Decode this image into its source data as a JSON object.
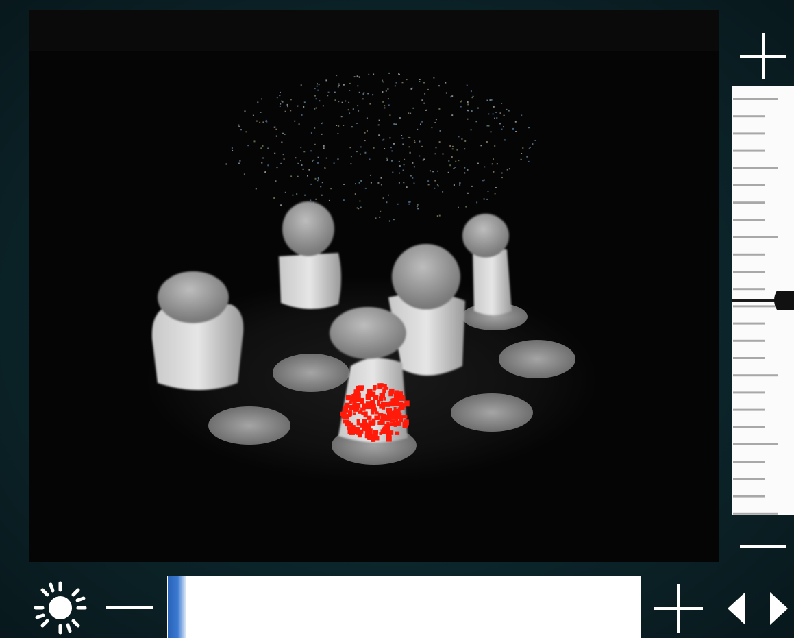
{
  "viewer": {
    "icons": {
      "zoom_in": "plus-icon",
      "zoom_out": "minus-icon",
      "brightness": "sun-icon",
      "brightness_down": "minus-icon",
      "brightness_up": "plus-icon",
      "prev": "triangle-left-icon",
      "next": "triangle-right-icon"
    },
    "colors": {
      "frame": "#0b2429",
      "track": "#ffffff",
      "slider_handle": "#3a78d0",
      "overlay_highlight": "#ff1a0a"
    },
    "vertical_slider": {
      "level": 0.5
    },
    "brightness_slider": {
      "level": 0.02
    }
  }
}
